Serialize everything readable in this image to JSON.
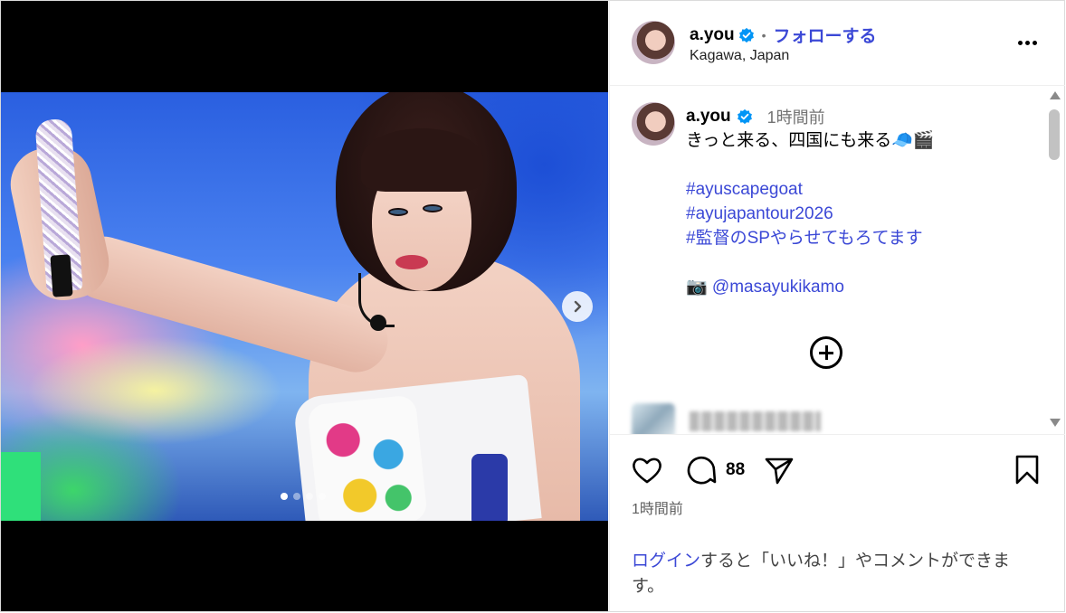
{
  "post": {
    "username": "a.you",
    "follow_label": "フォローする",
    "separator": "•",
    "location": "Kagawa, Japan",
    "time_ago": "1時間前",
    "caption_lines": [
      "きっと来る、四国にも来る🧢🎬",
      "",
      "#ayuscapegoat",
      "#ayujapantour2026",
      "#監督のSPやらせてもろてます",
      "",
      "📷 @masayukikamo"
    ],
    "comment_count": "88",
    "posted_time": "1時間前",
    "login_link": "ログイン",
    "login_rest": "すると「いいね！」やコメントができます。"
  },
  "carousel": {
    "total_slides": 4,
    "current_slide": 1
  },
  "icons": {
    "verified": "verified-badge-icon",
    "more": "more-options-icon",
    "next": "chevron-right-icon",
    "like": "heart-icon",
    "comment": "comment-bubble-icon",
    "share": "send-icon",
    "save": "bookmark-icon",
    "load_more": "plus-circle-icon"
  },
  "colors": {
    "accent": "#3b48d6",
    "verified": "#0095f6",
    "muted": "#737373"
  }
}
